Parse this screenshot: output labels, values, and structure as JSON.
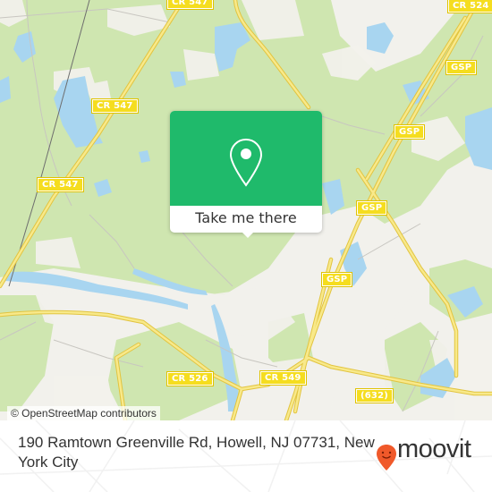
{
  "map": {
    "road_labels": [
      {
        "id": "cr547-top",
        "text": "CR 547"
      },
      {
        "id": "cr547-mid",
        "text": "CR 547"
      },
      {
        "id": "cr547-low",
        "text": "CR 547"
      },
      {
        "id": "cr524",
        "text": "CR 524"
      },
      {
        "id": "gsp-1",
        "text": "GSP"
      },
      {
        "id": "gsp-2",
        "text": "GSP"
      },
      {
        "id": "gsp-3",
        "text": "GSP"
      },
      {
        "id": "gsp-4",
        "text": "GSP"
      },
      {
        "id": "cr526",
        "text": "CR 526"
      },
      {
        "id": "cr549",
        "text": "CR 549"
      },
      {
        "id": "r632",
        "text": "(632)"
      }
    ],
    "colors": {
      "land": "#f2f1ec",
      "forest": "#cfe6b0",
      "water": "#a8d5f0",
      "road": "#f5dd6a",
      "road_border": "#e2c440",
      "minor_road": "#c8c6c0",
      "rail": "#6e6e6e"
    }
  },
  "popup": {
    "icon": "location-pin-icon",
    "button_label": "Take me there",
    "accent_color": "#1fba6b"
  },
  "attribution": "© OpenStreetMap contributors",
  "footer": {
    "address": "190 Ramtown Greenville Rd, Howell, NJ 07731, New York City",
    "brand": "moovit",
    "brand_icon": "moovit-smiley-pin-icon",
    "brand_color": "#f0592a"
  }
}
